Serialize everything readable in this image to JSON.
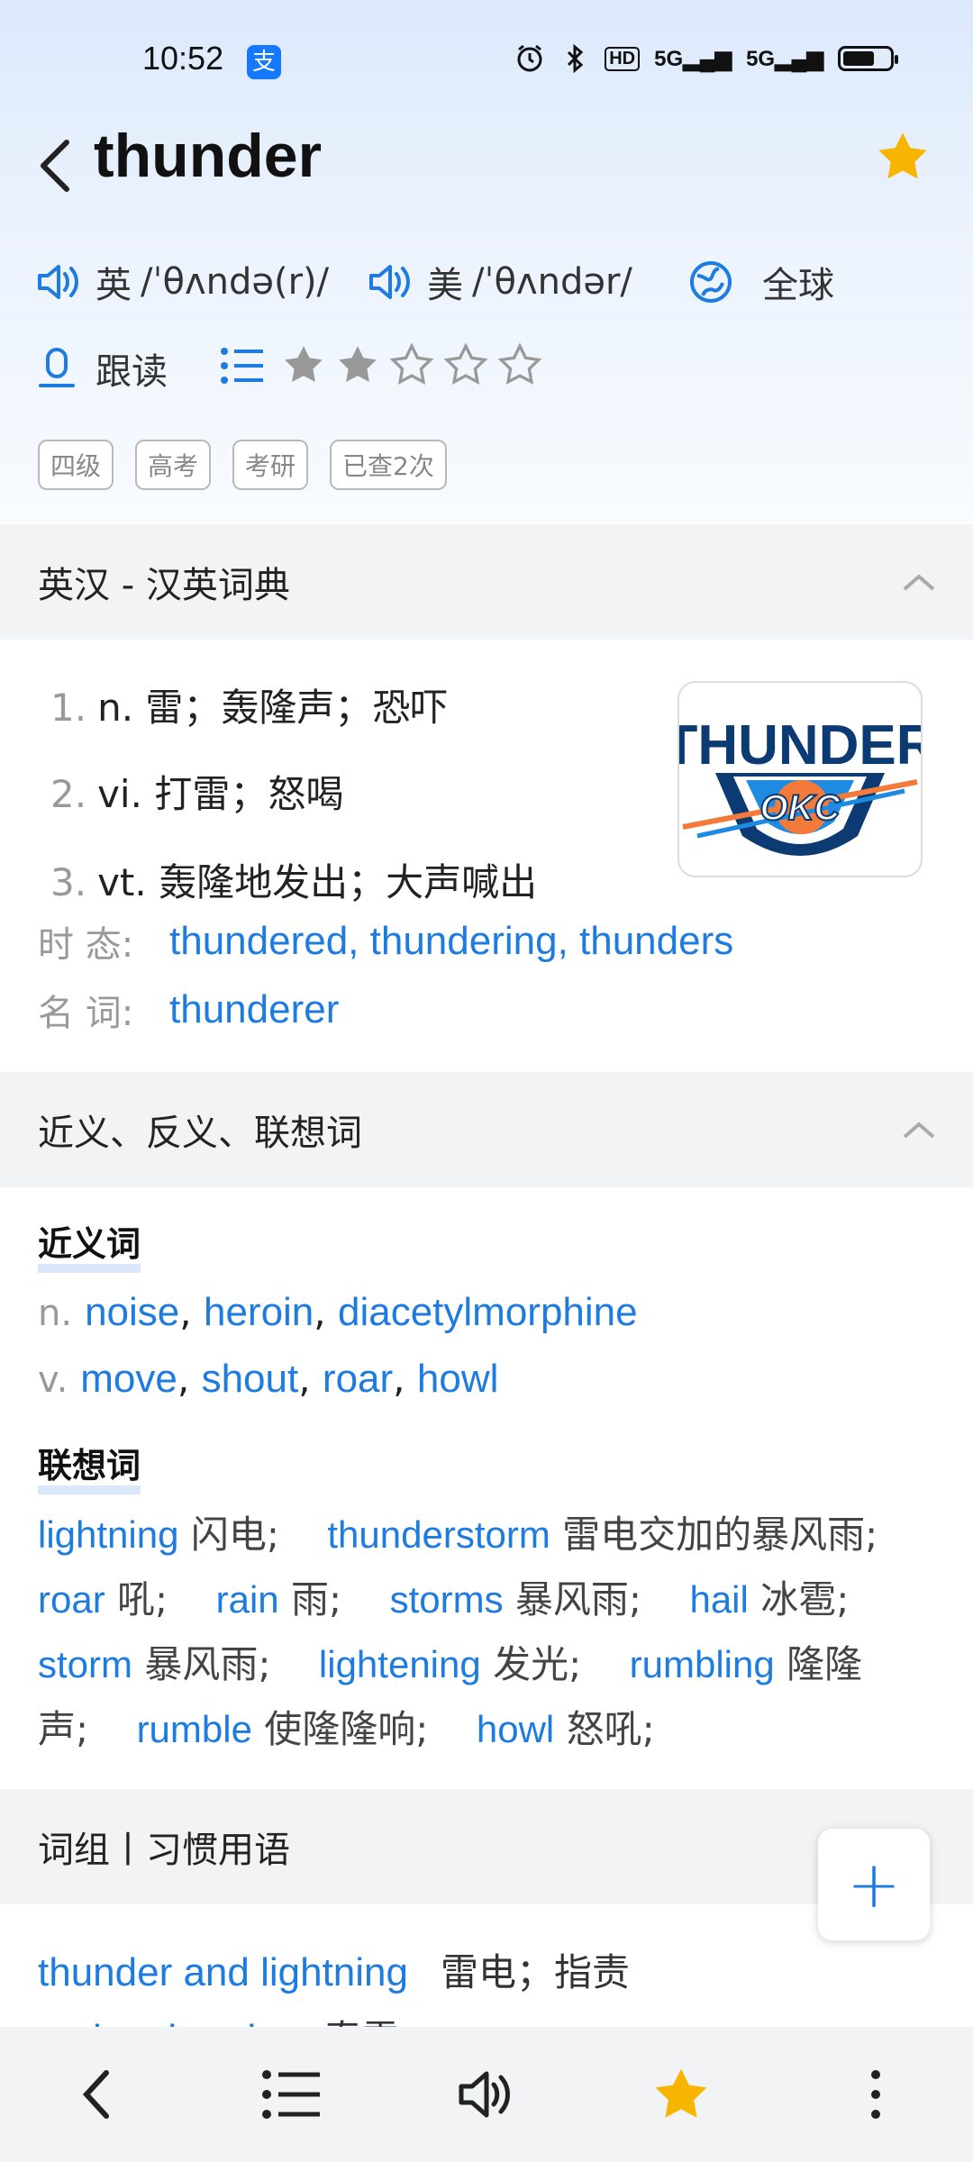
{
  "status_bar": {
    "time": "10:52",
    "alipay_glyph": "支",
    "hd_label": "HD",
    "signal1": "5G",
    "signal2": "5G",
    "icons": [
      "alarm-icon",
      "bluetooth-icon",
      "hd-icon",
      "signal-5g-icon",
      "signal-5g-icon",
      "battery-icon"
    ]
  },
  "header": {
    "word": "thunder",
    "favorite": true
  },
  "pronunciation": {
    "uk_label": "英",
    "uk_phonetic": "/ˈθʌndə(r)/",
    "us_label": "美",
    "us_phonetic": "/ˈθʌndər/",
    "global_label": "全球",
    "follow_read_label": "跟读",
    "rating_filled": 2,
    "rating_total": 5
  },
  "tags": [
    "四级",
    "高考",
    "考研",
    "已查2次"
  ],
  "dictionary": {
    "section_title": "英汉 - 汉英词典",
    "definitions": [
      {
        "num": "1.",
        "pos": "n.",
        "meaning": "雷；轰隆声；恐吓"
      },
      {
        "num": "2.",
        "pos": "vi.",
        "meaning": "打雷；怒喝"
      },
      {
        "num": "3.",
        "pos": "vt.",
        "meaning": "轰隆地发出；大声喊出"
      }
    ],
    "tense_label": "时 态:",
    "tense_value": "thundered, thundering, thunders",
    "noun_label": "名 词:",
    "noun_value": "thunderer",
    "logo_text": "THUNDER",
    "logo_badge": "OKC"
  },
  "synonyms": {
    "section_title": "近义、反义、联想词",
    "synonyms_title": "近义词",
    "n_label": "n.",
    "n_words": [
      "noise",
      "heroin",
      "diacetylmorphine"
    ],
    "v_label": "v.",
    "v_words": [
      "move",
      "shout",
      "roar",
      "howl"
    ],
    "assoc_title": "联想词",
    "assoc": [
      {
        "w": "lightning",
        "m": "闪电;"
      },
      {
        "w": "thunderstorm",
        "m": "雷电交加的暴风雨;"
      },
      {
        "w": "roar",
        "m": "吼;"
      },
      {
        "w": "rain",
        "m": "雨;"
      },
      {
        "w": "storms",
        "m": "暴风雨;"
      },
      {
        "w": "hail",
        "m": "冰雹;"
      },
      {
        "w": "storm",
        "m": "暴风雨;"
      },
      {
        "w": "lightening",
        "m": "发光;"
      },
      {
        "w": "rumbling",
        "m": "隆隆声;"
      },
      {
        "w": "rumble",
        "m": "使隆隆响;"
      },
      {
        "w": "howl",
        "m": "怒吼;"
      }
    ]
  },
  "phrases": {
    "section_title": "词组丨习惯用语",
    "items": [
      {
        "w": "thunder and lightning",
        "m": "雷电；指责"
      },
      {
        "w": "spring thunder",
        "m": "春雷"
      }
    ]
  },
  "fab": {
    "label": "+"
  },
  "bottom_nav": [
    "back-icon",
    "list-icon",
    "speaker-icon",
    "star-icon",
    "more-icon"
  ]
}
